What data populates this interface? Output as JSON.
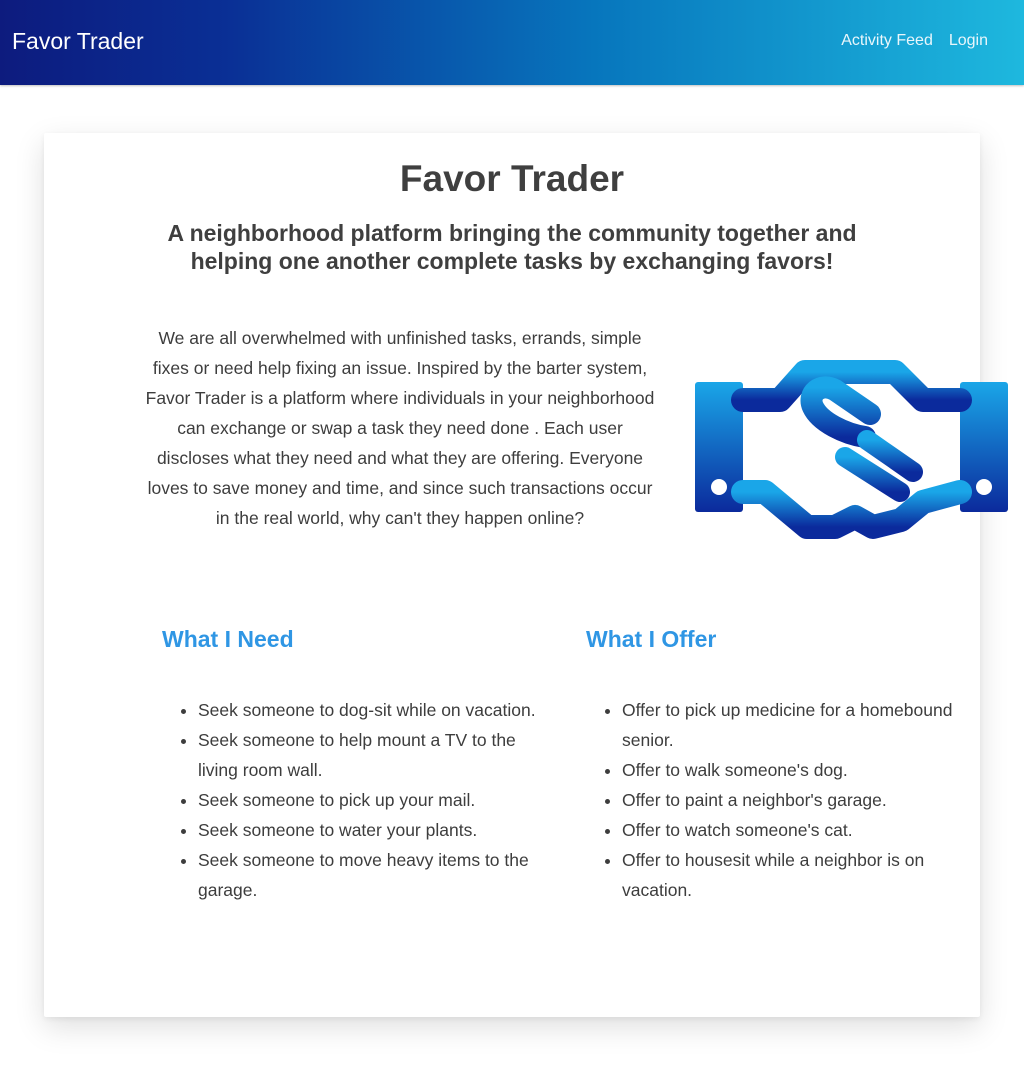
{
  "navbar": {
    "brand": "Favor Trader",
    "links": [
      "Activity Feed",
      "Login"
    ]
  },
  "hero": {
    "title": "Favor Trader",
    "tagline": "A neighborhood platform bringing the community together and helping one another complete tasks by exchanging favors!",
    "about": "We are all overwhelmed with unfinished tasks, errands, simple fixes or need help fixing an issue. Inspired by the barter system, Favor Trader is a platform where individuals in your neighborhood can exchange or swap a task they need done . Each user discloses what they need and what they are offering. Everyone loves to save money and time, and since such transactions occur in the real world, why can't they happen online?",
    "image_icon": "handshake-icon"
  },
  "need": {
    "heading": "What I Need",
    "items": [
      "Seek someone to dog-sit while on vacation.",
      "Seek someone to help mount a TV to the living room wall.",
      "Seek someone to pick up your mail.",
      "Seek someone to water your plants.",
      "Seek someone to move heavy items to the garage."
    ]
  },
  "offer": {
    "heading": "What I Offer",
    "items": [
      "Offer to pick up medicine for a homebound senior.",
      "Offer to walk someone's dog.",
      "Offer to paint a neighbor's garage.",
      "Offer to watch someone's cat.",
      "Offer to housesit while a neighbor is on vacation."
    ]
  },
  "colors": {
    "navbar_start": "#0d1b7e",
    "navbar_end": "#1eb8de",
    "heading_accent": "#2f96e4",
    "icon_top": "#1aa6e8",
    "icon_bottom": "#0b2a9c",
    "text": "#3d3d3d"
  }
}
